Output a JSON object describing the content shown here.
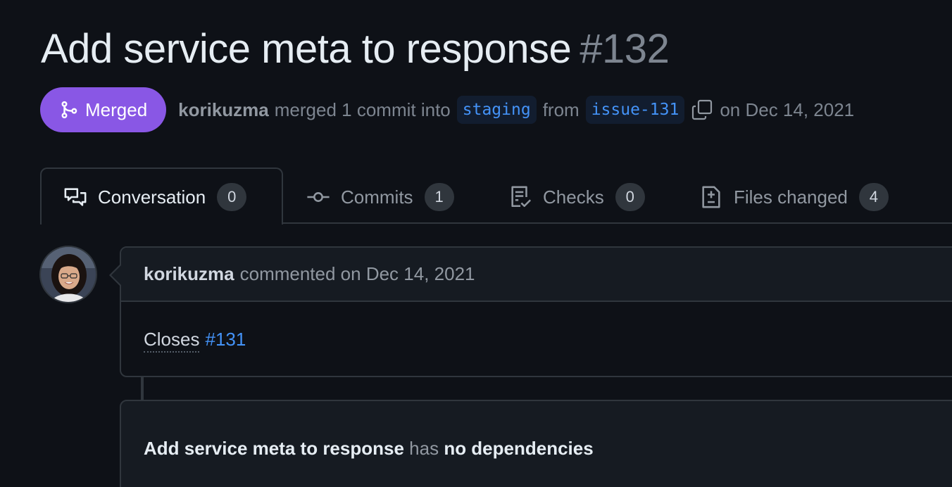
{
  "pull_request": {
    "title": "Add service meta to response",
    "number": "#132",
    "state": "Merged",
    "author": "korikuzma",
    "merged_text": "merged 1 commit into",
    "base_branch": "staging",
    "from_text": "from",
    "head_branch": "issue-131",
    "date_text": "on Dec 14, 2021"
  },
  "tabs": [
    {
      "label": "Conversation",
      "count": "0",
      "icon": "comment-discussion-icon",
      "active": true
    },
    {
      "label": "Commits",
      "count": "1",
      "icon": "git-commit-icon",
      "active": false
    },
    {
      "label": "Checks",
      "count": "0",
      "icon": "checklist-icon",
      "active": false
    },
    {
      "label": "Files changed",
      "count": "4",
      "icon": "file-diff-icon",
      "active": false
    }
  ],
  "comment": {
    "author": "korikuzma",
    "action_text": "commented on Dec 14, 2021",
    "body_prefix": "Closes",
    "issue_link": "#131"
  },
  "dependencies": {
    "title": "Add service meta to response",
    "has_text": "has",
    "status": "no dependencies"
  },
  "colors": {
    "background": "#0e1117",
    "merged_purple": "#8957e5",
    "link_blue": "#4493f8",
    "border": "#30363d"
  }
}
